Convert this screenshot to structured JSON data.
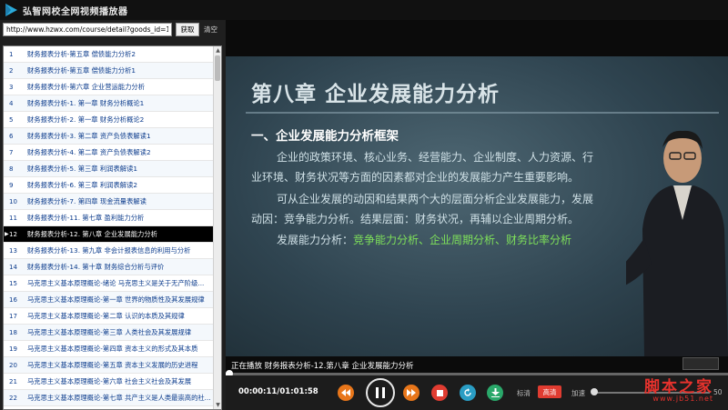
{
  "window": {
    "title": "弘智网校全网视频播放器"
  },
  "urlbar": {
    "value": "http://www.hzwx.com/course/detail?goods_id=110",
    "fetch_label": "获取",
    "clear_label": "清空"
  },
  "playlist": {
    "active_index": 11,
    "items": [
      {
        "num": "1",
        "title": "财务报表分析-第五章  偿债能力分析2"
      },
      {
        "num": "2",
        "title": "财务报表分析-第五章  偿债能力分析1"
      },
      {
        "num": "3",
        "title": "财务报表分析-第六章  企业营运能力分析"
      },
      {
        "num": "4",
        "title": "财务报表分析-1. 第一章    财务分析概论1"
      },
      {
        "num": "5",
        "title": "财务报表分析-2. 第一章    财务分析概论2"
      },
      {
        "num": "6",
        "title": "财务报表分析-3. 第二章    资产负债表解读1"
      },
      {
        "num": "7",
        "title": "财务报表分析-4. 第二章    资产负债表解读2"
      },
      {
        "num": "8",
        "title": "财务报表分析-5. 第三章       利润表解读1"
      },
      {
        "num": "9",
        "title": "财务报表分析-6. 第三章       利润表解读2"
      },
      {
        "num": "10",
        "title": "财务报表分析-7. 第四章       现金流量表解读"
      },
      {
        "num": "11",
        "title": "财务报表分析-11. 第七章  盈利能力分析"
      },
      {
        "num": "12",
        "title": "财务报表分析-12. 第八章  企业发展能力分析"
      },
      {
        "num": "13",
        "title": "财务报表分析-13. 第九章  非会计报表信息的利用与分析"
      },
      {
        "num": "14",
        "title": "财务报表分析-14. 第十章  财务综合分析与评价"
      },
      {
        "num": "15",
        "title": "马克思主义基本原理概论-绪论    马克思主义是关于无产阶级..."
      },
      {
        "num": "16",
        "title": "马克思主义基本原理概论-第一章    世界的物质性及其发展规律"
      },
      {
        "num": "17",
        "title": "马克思主义基本原理概论-第二章    认识的本质及其规律"
      },
      {
        "num": "18",
        "title": "马克思主义基本原理概论-第三章  人类社会及其发展规律"
      },
      {
        "num": "19",
        "title": "马克思主义基本原理概论-第四章  资本主义的形式及其本质"
      },
      {
        "num": "20",
        "title": "马克思主义基本原理概论-第五章  资本主义发展的历史进程"
      },
      {
        "num": "21",
        "title": "马克思主义基本原理概论-第六章  社会主义社会及其发展"
      },
      {
        "num": "22",
        "title": "马克思主义基本原理概论-第七章  共产主义是人类最崇高的社..."
      }
    ]
  },
  "slide": {
    "title": "第八章   企业发展能力分析",
    "heading": "一、企业发展能力分析框架",
    "para1_line1": "企业的政策环境、核心业务、经营能力、企业制度、人力资源、行",
    "para1_line2": "业环境、财务状况等方面的因素都对企业的发展能力产生重要影响。",
    "para2_line1": "可从企业发展的动因和结果两个大的层面分析企业发展能力，发展",
    "para2_line2": "动因：竞争能力分析。结果层面：财务状况，再辅以企业周期分析。",
    "para3_prefix": "发展能力分析：",
    "para3_green": "竞争能力分析、企业周期分析、财务比率分析"
  },
  "caption": "正在播放 财务报表分析-12.第八章 企业发展能力分析",
  "controls": {
    "timecode": "00:00:11/01:01:58",
    "progress": 0.003,
    "quality_label": "标清",
    "quality_active": "高清",
    "speed_label": "加速",
    "speed_value": "50",
    "speed_level": 0.0
  },
  "icons": [
    "rewind-icon",
    "pause-icon",
    "forward-icon",
    "stop-icon",
    "refresh-icon",
    "download-icon",
    "play-logo-icon"
  ],
  "watermark": {
    "top": "脚本之家",
    "bottom": "www.jb51.net"
  },
  "colors": {
    "active_row": "#000000",
    "row_text": "#0b3b8c",
    "quality_red": "#e03c31",
    "watermark_red": "#e6322d",
    "orange_btn": "#e8761a",
    "red_btn": "#e03c31",
    "teal_btn": "#2a9dc4",
    "green_btn": "#2aa86a"
  }
}
